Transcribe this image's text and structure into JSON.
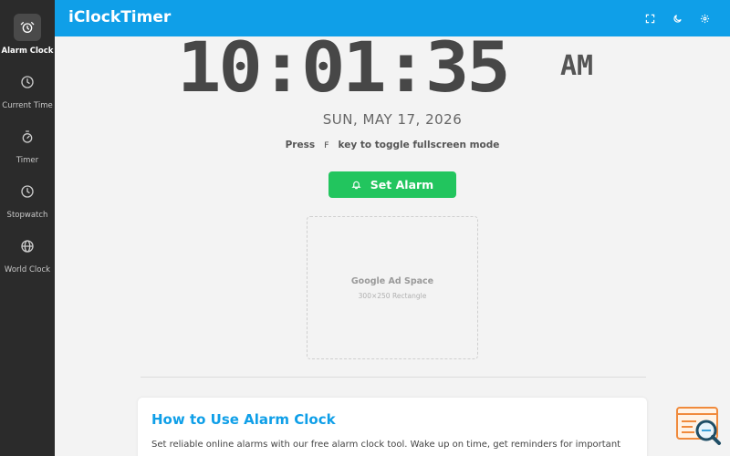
{
  "app": {
    "title": "iClockTimer"
  },
  "sidebar": {
    "items": [
      {
        "label": "Alarm Clock",
        "icon": "alarm-clock-icon",
        "active": true
      },
      {
        "label": "Current Time",
        "icon": "clock-icon"
      },
      {
        "label": "Timer",
        "icon": "timer-icon"
      },
      {
        "label": "Stopwatch",
        "icon": "stopwatch-icon"
      },
      {
        "label": "World Clock",
        "icon": "globe-icon"
      }
    ]
  },
  "header": {
    "buttons": [
      {
        "icon": "fullscreen-icon"
      },
      {
        "icon": "moon-icon"
      },
      {
        "icon": "settings-gear-icon"
      }
    ]
  },
  "clock": {
    "time": "10:01:35",
    "ampm": "AM",
    "date": "SUN, MAY 17, 2026",
    "hint_prefix": "Press",
    "hint_key": "F",
    "hint_suffix": "key to toggle fullscreen mode"
  },
  "actions": {
    "set_alarm_label": "Set Alarm"
  },
  "ad": {
    "title": "Google Ad Space",
    "subtitle": "300×250 Rectangle"
  },
  "content": {
    "title": "How to Use Alarm Clock",
    "text": "Set reliable online alarms with our free alarm clock tool. Wake up on time, get reminders for important"
  },
  "colors": {
    "accent": "#0f9fe8",
    "success": "#22c55e",
    "sidebar_bg": "#2b2b2b"
  }
}
